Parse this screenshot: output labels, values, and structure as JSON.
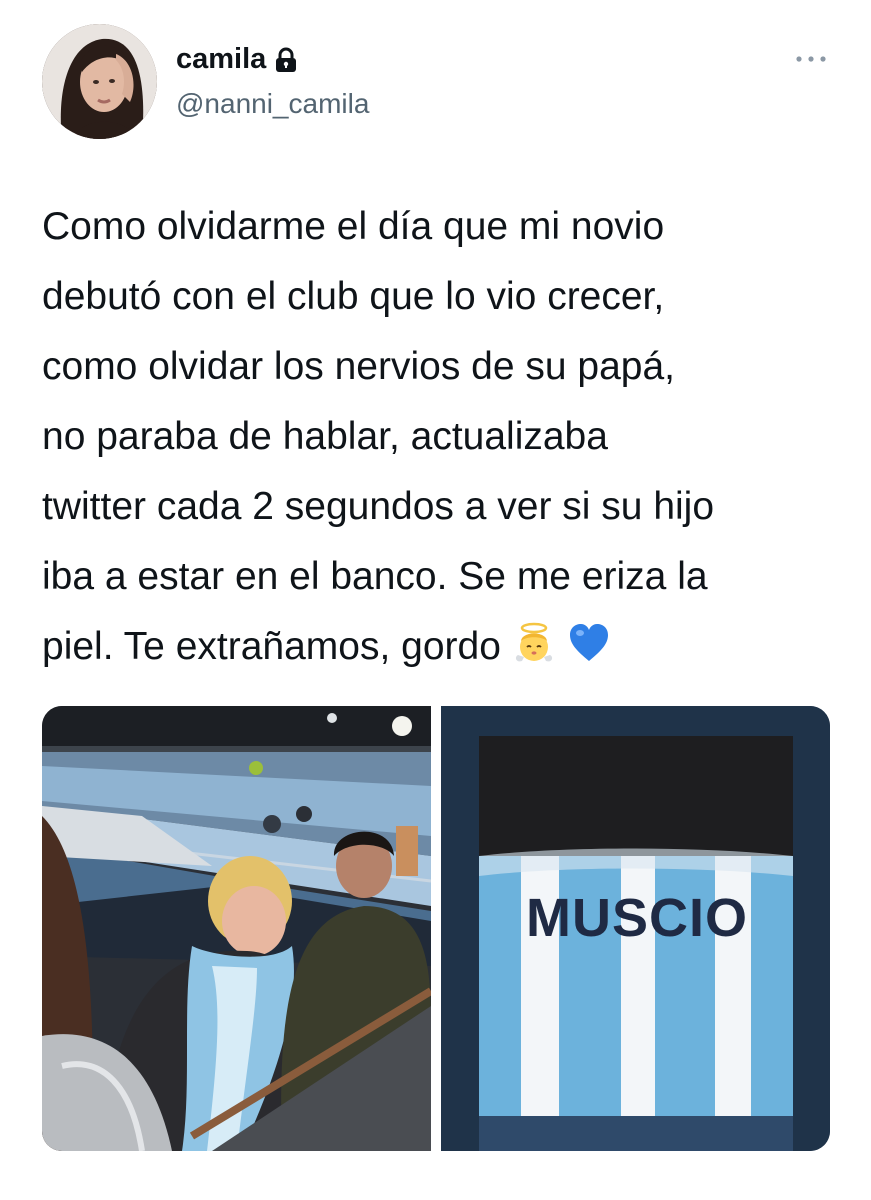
{
  "author": {
    "display_name": "camila",
    "handle": "@nanni_camila",
    "protected": true,
    "lock_icon": "lock-icon"
  },
  "tweet": {
    "lines": [
      "Como olvidarme el día que mi novio",
      "debutó con el club que lo vio crecer,",
      "como olvidar los nervios de su papá,",
      "no paraba de hablar, actualizaba",
      "twitter cada 2 segundos a ver si su hijo",
      "iba a estar en el banco. Se me eriza la",
      "piel. Te extrañamos, gordo"
    ],
    "emojis": [
      "angel-emoji",
      "blue-heart-emoji"
    ]
  },
  "media": {
    "photos": [
      {
        "name": "stadium-photo"
      },
      {
        "name": "jersey-photo",
        "jersey_text": "MUSCIO"
      }
    ]
  },
  "colors": {
    "text": "#0f1419",
    "secondary": "#536471",
    "jersey_sky_blue": "#6cb2dc",
    "heart_blue": "#2f7fe6"
  }
}
